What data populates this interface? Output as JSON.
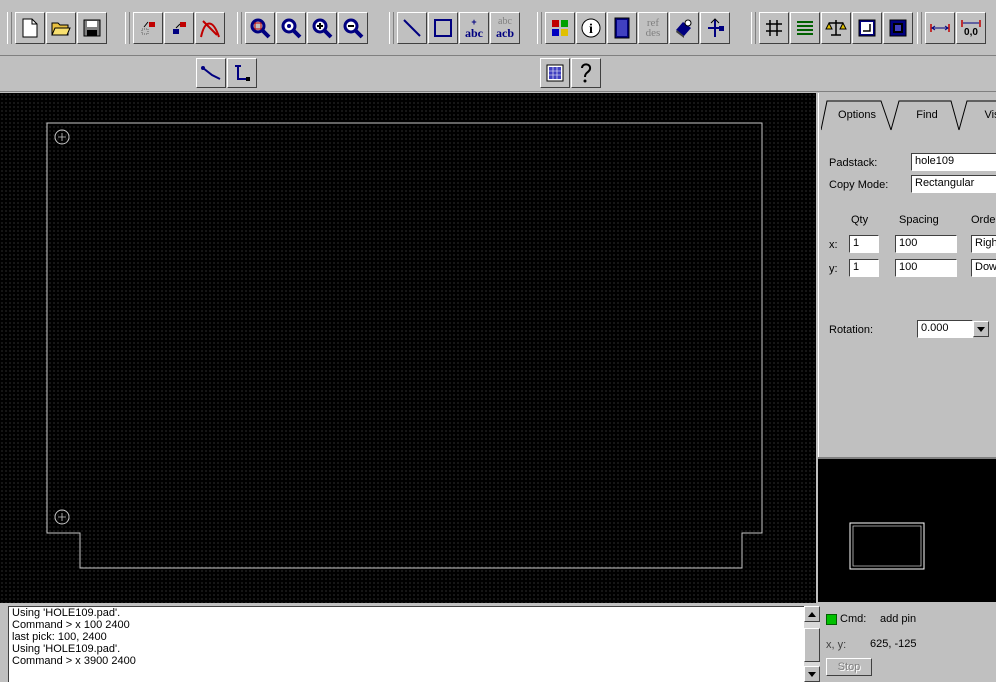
{
  "toolbar": {
    "text_icon_abc": "abc",
    "text_icon_acb_top": "abc",
    "text_icon_acb_bottom": "acb",
    "text_icon_ref": "ref",
    "text_icon_des": "des",
    "text_icon_origin": "0,0"
  },
  "panel": {
    "tabs": [
      "Options",
      "Find",
      "Vis"
    ],
    "padstack_label": "Padstack:",
    "padstack_value": "hole109",
    "copy_mode_label": "Copy Mode:",
    "copy_mode_value": "Rectangular",
    "qty_header": "Qty",
    "spacing_header": "Spacing",
    "order_header": "Order",
    "x_label": "x:",
    "y_label": "y:",
    "x_qty": "1",
    "y_qty": "1",
    "x_spacing": "100",
    "y_spacing": "100",
    "x_order": "Right",
    "y_order": "Down",
    "rotation_label": "Rotation:",
    "rotation_value": "0.000"
  },
  "console": {
    "lines": [
      "Using 'HOLE109.pad'.",
      "Command > x 100 2400",
      "last pick:  100, 2400",
      "Using 'HOLE109.pad'.",
      "Command > x 3900 2400"
    ]
  },
  "status": {
    "cmd_label": "Cmd:",
    "cmd_value": "add pin",
    "xy_label": "x, y:",
    "xy_value": "625, -125",
    "stop_label": "Stop"
  },
  "colors": {
    "canvas_bg": "#000000",
    "grid_dot": "#5a5a5a",
    "outline": "#c8c8c8",
    "cmd_led": "#00c000"
  }
}
